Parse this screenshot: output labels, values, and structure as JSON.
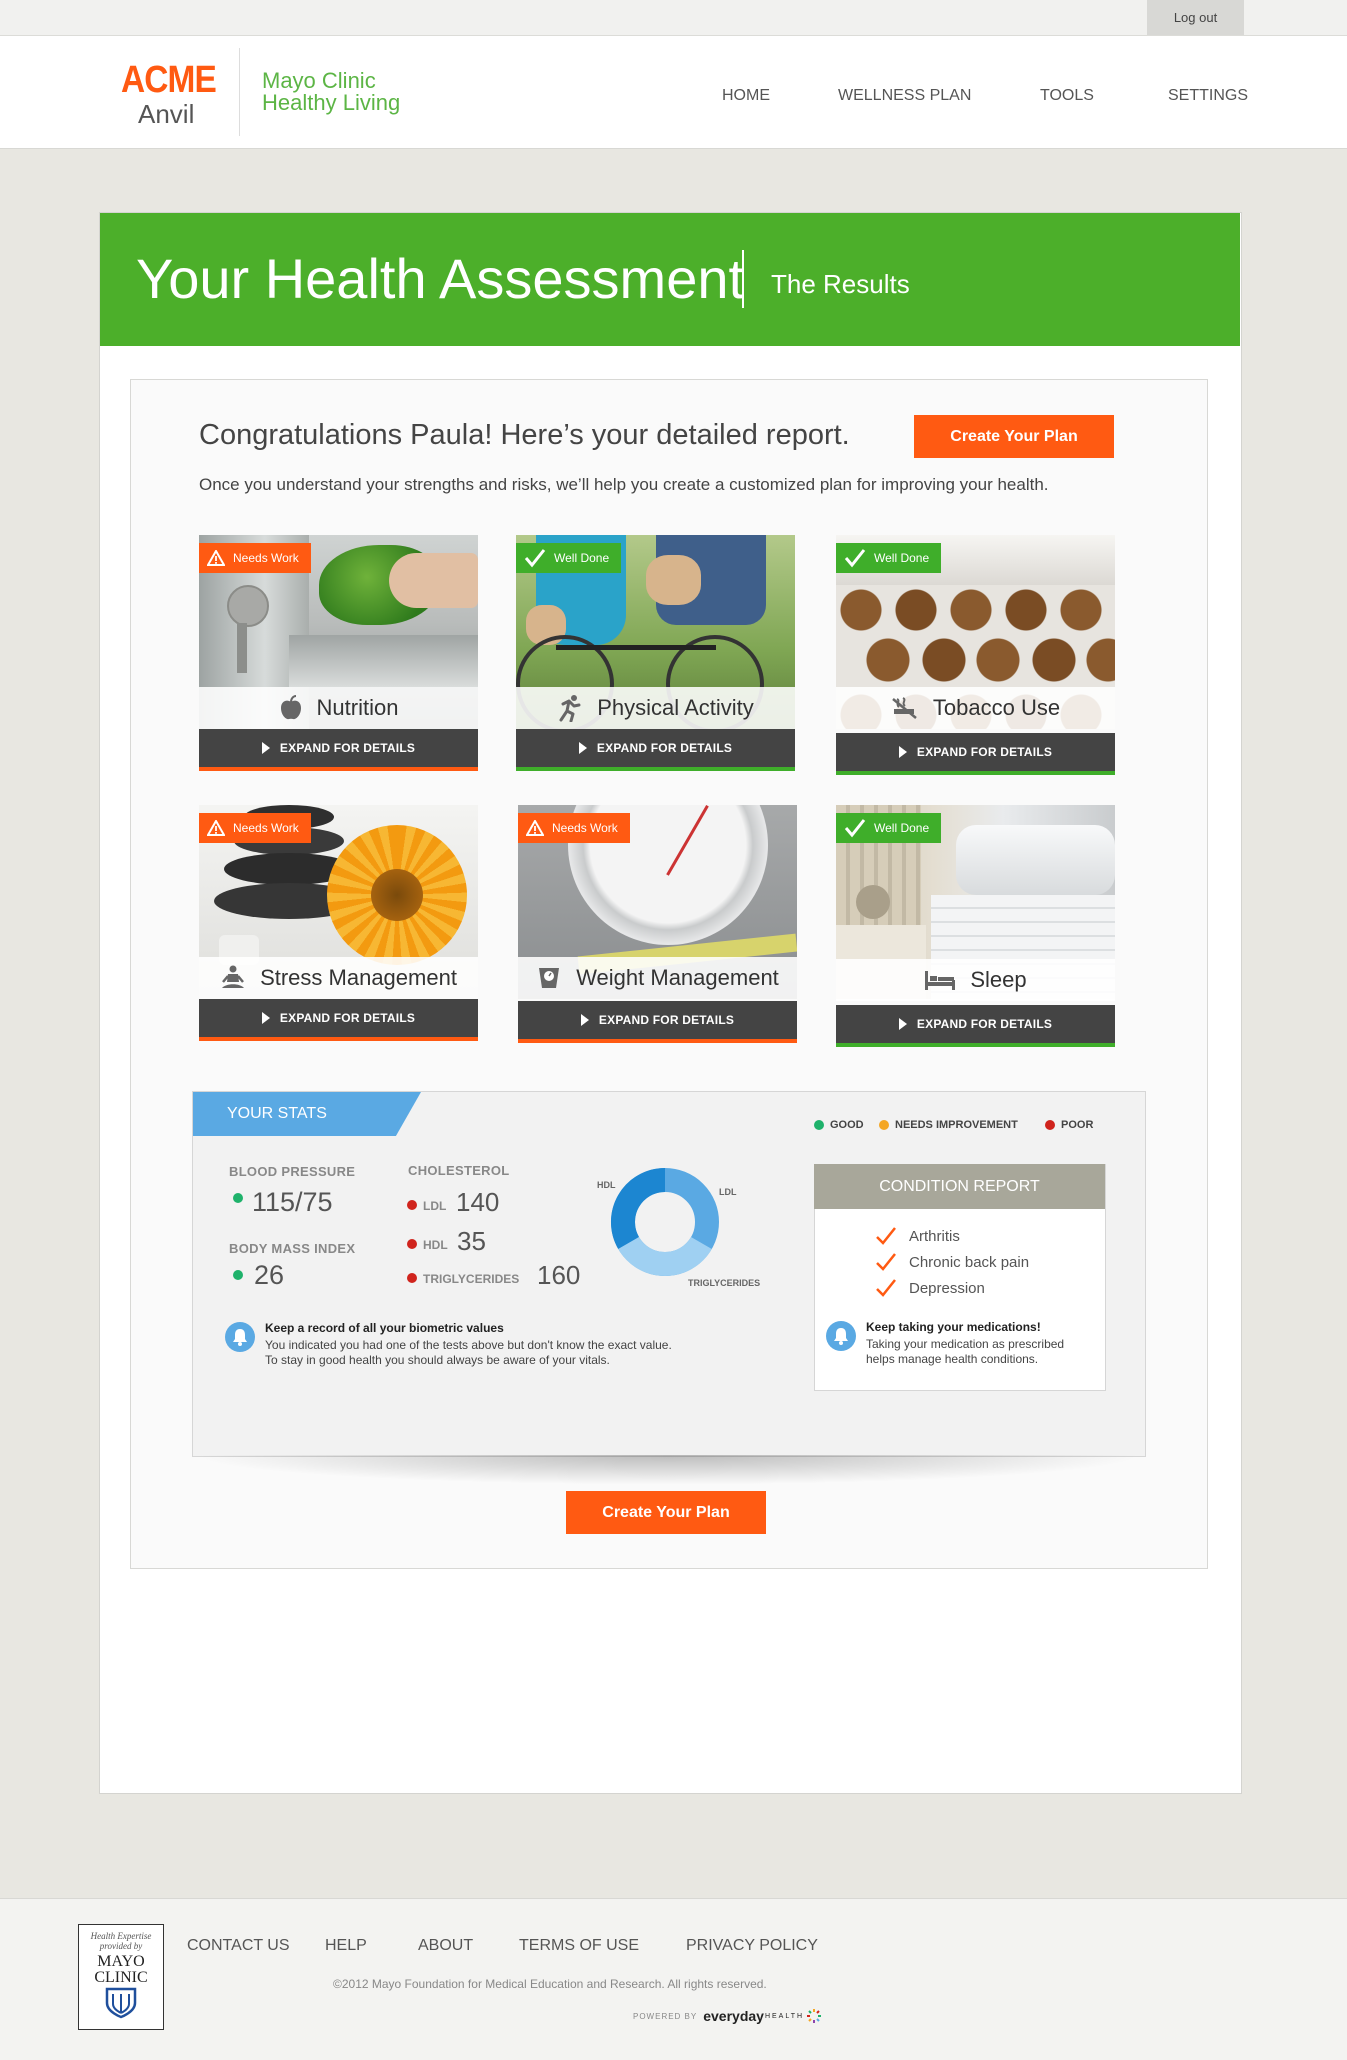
{
  "topbar": {
    "logout": "Log out"
  },
  "header": {
    "brand_top": "ACME",
    "brand_bottom": "Anvil",
    "partner_line1": "Mayo Clinic",
    "partner_line2": "Healthy Living",
    "nav": [
      "HOME",
      "WELLNESS PLAN",
      "TOOLS",
      "SETTINGS"
    ]
  },
  "banner": {
    "title": "Your Health Assessment",
    "subtitle": "The Results"
  },
  "report": {
    "heading": "Congratulations Paula! Here’s your detailed report.",
    "intro": "Once you understand your strengths and risks, we’ll help you create a customized plan for improving your health.",
    "cta": "Create Your Plan"
  },
  "tiles": [
    {
      "title": "Nutrition",
      "badge": "Needs Work",
      "status": "needs",
      "action": "EXPAND FOR DETAILS",
      "icon": "apple-icon"
    },
    {
      "title": "Physical Activity",
      "badge": "Well Done",
      "status": "done",
      "action": "EXPAND FOR DETAILS",
      "icon": "runner-icon"
    },
    {
      "title": "Tobacco Use",
      "badge": "Well Done",
      "status": "done",
      "action": "EXPAND FOR DETAILS",
      "icon": "no-smoking-icon"
    },
    {
      "title": "Stress Management",
      "badge": "Needs Work",
      "status": "needs",
      "action": "EXPAND FOR DETAILS",
      "icon": "meditation-icon"
    },
    {
      "title": "Weight Management",
      "badge": "Needs Work",
      "status": "needs",
      "action": "EXPAND FOR DETAILS",
      "icon": "scale-icon"
    },
    {
      "title": "Sleep",
      "badge": "Well Done",
      "status": "done",
      "action": "EXPAND FOR DETAILS",
      "icon": "bed-icon"
    }
  ],
  "stats": {
    "tab": "YOUR STATS",
    "legend": [
      {
        "label": "GOOD",
        "color": "#1fb26b"
      },
      {
        "label": "NEEDS IMPROVEMENT",
        "color": "#f4a623"
      },
      {
        "label": "POOR",
        "color": "#d0241d"
      }
    ],
    "blood_pressure": {
      "label": "BLOOD PRESSURE",
      "value": "115/75"
    },
    "bmi": {
      "label": "BODY MASS INDEX",
      "value": "26"
    },
    "cholesterol": {
      "label": "CHOLESTEROL",
      "ldl": {
        "label": "LDL",
        "value": "140"
      },
      "hdl": {
        "label": "HDL",
        "value": "35"
      },
      "trig": {
        "label": "TRIGLYCERIDES",
        "value": "160"
      }
    },
    "donut": {
      "hdl": "HDL",
      "ldl": "LDL",
      "trig": "TRIGLYCERIDES"
    },
    "note": {
      "title": "Keep a record of all your biometric values",
      "line1": "You indicated you had one of the tests above but don't know the exact value.",
      "line2": "To stay in good health you should always be aware of your vitals."
    },
    "condition": {
      "title": "CONDITION REPORT",
      "items": [
        "Arthritis",
        "Chronic back pain",
        "Depression"
      ],
      "note_title": "Keep taking your medications!",
      "note_line1": "Taking your medication as prescribed",
      "note_line2": "helps manage health conditions."
    }
  },
  "footer": {
    "links": [
      "CONTACT US",
      "HELP",
      "ABOUT",
      "TERMS OF USE",
      "PRIVACY POLICY"
    ],
    "copyright": "©2012 Mayo Foundation for Medical Education and Research. All rights reserved.",
    "powered_by": "POWERED BY",
    "powered_brand": "everyday",
    "powered_brand2": "HEALTH",
    "logo_line1": "Health Expertise",
    "logo_line2": "provided by",
    "logo_line3": "MAYO",
    "logo_line4": "CLINIC"
  }
}
